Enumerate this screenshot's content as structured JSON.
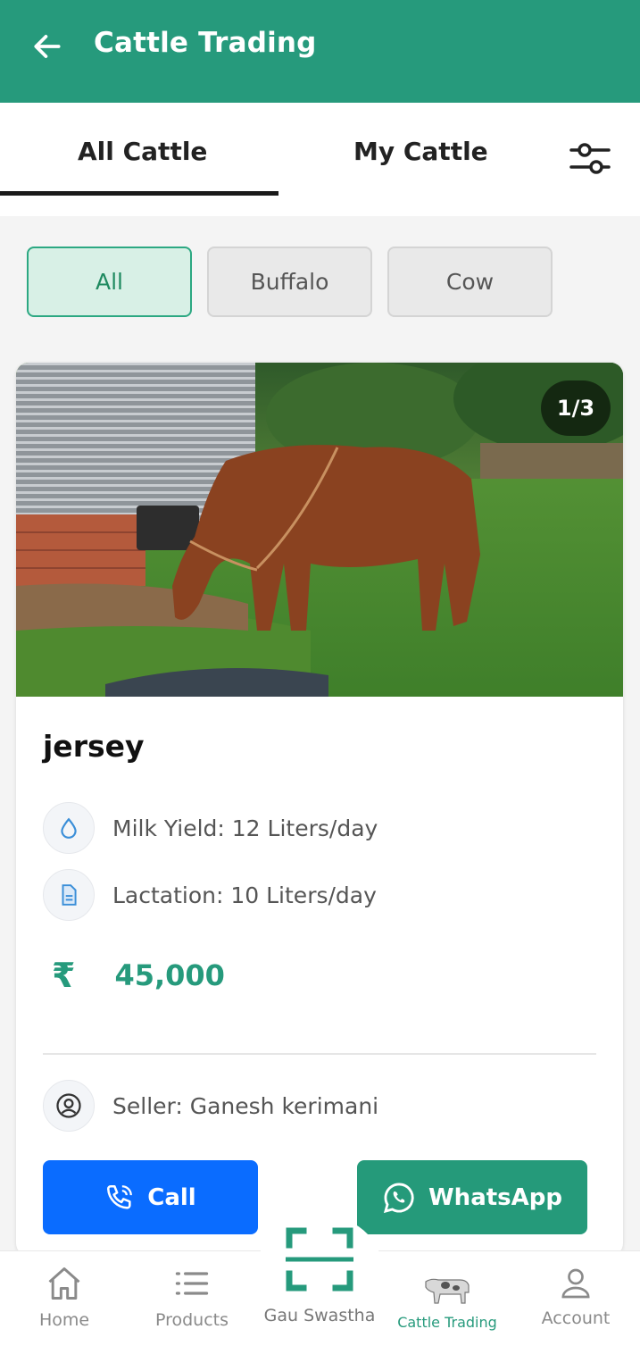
{
  "header": {
    "title": "Cattle Trading",
    "back_icon": "arrow-left-icon"
  },
  "tabs": [
    {
      "label": "All Cattle",
      "active": true
    },
    {
      "label": "My Cattle",
      "active": false
    }
  ],
  "filter_chips": [
    {
      "label": "All",
      "active": true
    },
    {
      "label": "Buffalo",
      "active": false
    },
    {
      "label": "Cow",
      "active": false
    }
  ],
  "listing": {
    "image_counter": "1/3",
    "breed": "jersey",
    "milk_yield": "Milk Yield: 12 Liters/day",
    "lactation": "Lactation: 10 Liters/day",
    "currency_symbol": "₹",
    "price": "45,000",
    "seller": "Seller: Ganesh kerimani",
    "call_label": "Call",
    "whatsapp_label": "WhatsApp"
  },
  "bottom_nav": {
    "home": "Home",
    "products": "Products",
    "scan": "Gau Swastha",
    "cattle": "Cattle Trading",
    "account": "Account",
    "active": "cattle"
  },
  "colors": {
    "primary": "#269a7c",
    "call_blue": "#0a6cff",
    "chip_active_bg": "#d8f0e6"
  }
}
